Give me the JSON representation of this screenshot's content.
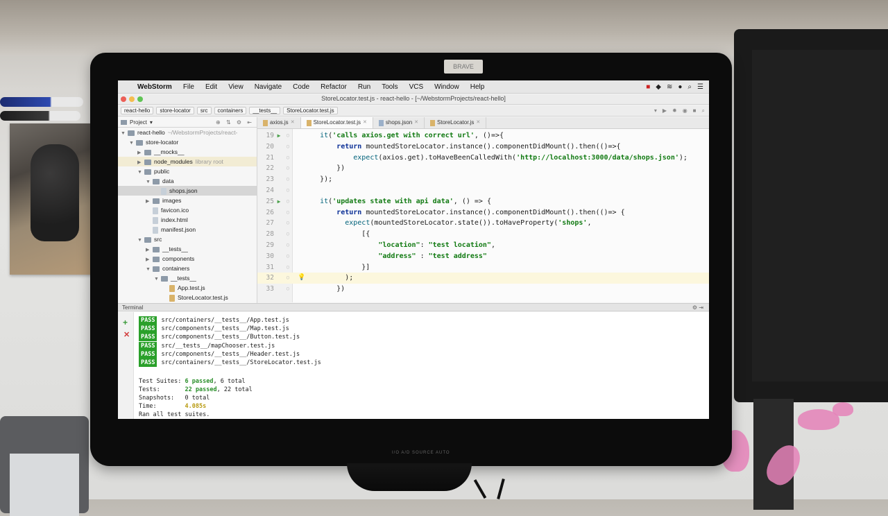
{
  "app": {
    "name": "WebStorm",
    "window_title": "StoreLocator.test.js - react-hello - [~/WebstormProjects/react-hello]"
  },
  "sticker": "BRAVE",
  "menu": [
    "File",
    "Edit",
    "View",
    "Navigate",
    "Code",
    "Refactor",
    "Run",
    "Tools",
    "VCS",
    "Window",
    "Help"
  ],
  "breadcrumbs": [
    "react-hello",
    "store-locator",
    "src",
    "containers",
    "__tests__",
    "StoreLocator.test.js"
  ],
  "project_panel": {
    "title": "Project",
    "tree": [
      {
        "label": "react-hello",
        "note": "~/WebstormProjects/react-",
        "depth": 0,
        "expanded": true
      },
      {
        "label": "store-locator",
        "depth": 1,
        "expanded": true
      },
      {
        "label": "__mocks__",
        "depth": 2,
        "expanded": false
      },
      {
        "label": "node_modules",
        "note": "library root",
        "depth": 2,
        "expanded": false
      },
      {
        "label": "public",
        "depth": 2,
        "expanded": true
      },
      {
        "label": "data",
        "depth": 3,
        "expanded": true
      },
      {
        "label": "shops.json",
        "depth": 4,
        "file": true,
        "selected": true
      },
      {
        "label": "images",
        "depth": 3,
        "expanded": false
      },
      {
        "label": "favicon.ico",
        "depth": 3,
        "file": true
      },
      {
        "label": "index.html",
        "depth": 3,
        "file": true
      },
      {
        "label": "manifest.json",
        "depth": 3,
        "file": true
      },
      {
        "label": "src",
        "depth": 2,
        "expanded": true
      },
      {
        "label": "__tests__",
        "depth": 3,
        "expanded": false
      },
      {
        "label": "components",
        "depth": 3,
        "expanded": false
      },
      {
        "label": "containers",
        "depth": 3,
        "expanded": true
      },
      {
        "label": "__tests__",
        "depth": 4,
        "expanded": true
      },
      {
        "label": "App.test.js",
        "depth": 5,
        "file": true,
        "js": true
      },
      {
        "label": "StoreLocator.test.js",
        "depth": 5,
        "file": true,
        "js": true
      }
    ]
  },
  "tabs": [
    {
      "label": "axios.js",
      "active": false
    },
    {
      "label": "StoreLocator.test.js",
      "active": true
    },
    {
      "label": "shops.json",
      "active": false
    },
    {
      "label": "StoreLocator.js",
      "active": false
    }
  ],
  "code": [
    {
      "n": "19",
      "run": true,
      "text": "    it('calls axios.get with correct url', ()=>{"
    },
    {
      "n": "20",
      "text": "        return mountedStoreLocator.instance().componentDidMount().then(()=>{"
    },
    {
      "n": "21",
      "text": "            expect(axios.get).toHaveBeenCalledWith('http://localhost:3000/data/shops.json');"
    },
    {
      "n": "22",
      "text": "        })"
    },
    {
      "n": "23",
      "text": "    });"
    },
    {
      "n": "24",
      "text": ""
    },
    {
      "n": "25",
      "run": true,
      "text": "    it('updates state with api data', () => {"
    },
    {
      "n": "26",
      "text": "        return mountedStoreLocator.instance().componentDidMount().then(()=> {"
    },
    {
      "n": "27",
      "text": "          expect(mountedStoreLocator.state()).toHaveProperty('shops',"
    },
    {
      "n": "28",
      "text": "              [{"
    },
    {
      "n": "29",
      "text": "                  \"location\": \"test location\","
    },
    {
      "n": "30",
      "text": "                  \"address\" : \"test address\""
    },
    {
      "n": "31",
      "text": "              }]"
    },
    {
      "n": "32",
      "current": true,
      "bulb": true,
      "text": "          );"
    },
    {
      "n": "33",
      "text": "        })"
    }
  ],
  "terminal": {
    "title": "Terminal",
    "passes": [
      "src/containers/__tests__/App.test.js",
      "src/components/__tests__/Map.test.js",
      "src/components/__tests__/Button.test.js",
      "src/__tests__/mapChooser.test.js",
      "src/components/__tests__/Header.test.js",
      "src/containers/__tests__/StoreLocator.test.js"
    ],
    "pass_label": "PASS",
    "summary": {
      "suites_label": "Test Suites:",
      "suites_passed": "6 passed",
      "suites_total": ", 6 total",
      "tests_label": "Tests:",
      "tests_passed": "22 passed",
      "tests_total": ", 22 total",
      "snapshots_label": "Snapshots:",
      "snapshots_value": "0 total",
      "time_label": "Time:",
      "time_value": "4.085s",
      "footer": "Ran all test suites."
    }
  },
  "monitor_label": "I/O  A/D  SOURCE  AUTO"
}
